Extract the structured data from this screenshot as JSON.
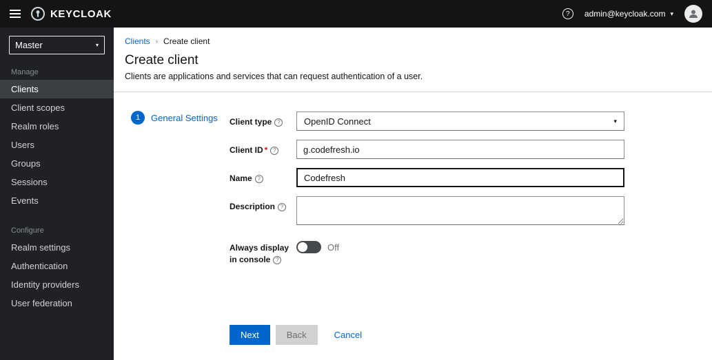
{
  "topbar": {
    "brand": "KEYCLOAK",
    "user_email": "admin@keycloak.com"
  },
  "sidebar": {
    "realm_selector": "Master",
    "sections": [
      {
        "label": "Manage",
        "items": [
          "Clients",
          "Client scopes",
          "Realm roles",
          "Users",
          "Groups",
          "Sessions",
          "Events"
        ]
      },
      {
        "label": "Configure",
        "items": [
          "Realm settings",
          "Authentication",
          "Identity providers",
          "User federation"
        ]
      }
    ],
    "active_item": "Clients"
  },
  "breadcrumb": {
    "parent": "Clients",
    "current": "Create client"
  },
  "page": {
    "title": "Create client",
    "subtitle": "Clients are applications and services that can request authentication of a user."
  },
  "wizard": {
    "step_number": "1",
    "step_label": "General Settings"
  },
  "form": {
    "client_type": {
      "label": "Client type",
      "value": "OpenID Connect"
    },
    "client_id": {
      "label": "Client ID",
      "required_marker": "*",
      "value": "g.codefresh.io"
    },
    "name": {
      "label": "Name",
      "value": "Codefresh"
    },
    "description": {
      "label": "Description",
      "value": ""
    },
    "always_display": {
      "label": "Always display in console",
      "state": "Off"
    }
  },
  "actions": {
    "next": "Next",
    "back": "Back",
    "cancel": "Cancel"
  },
  "icons": {
    "help": "?",
    "caret_down": "▾",
    "breadcrumb_sep": "›"
  },
  "colors": {
    "accent": "#0066cc",
    "topbar_bg": "#141414",
    "sidebar_bg": "#1f2124",
    "active_item_bg": "#3c3f42",
    "required": "#c9190b"
  }
}
